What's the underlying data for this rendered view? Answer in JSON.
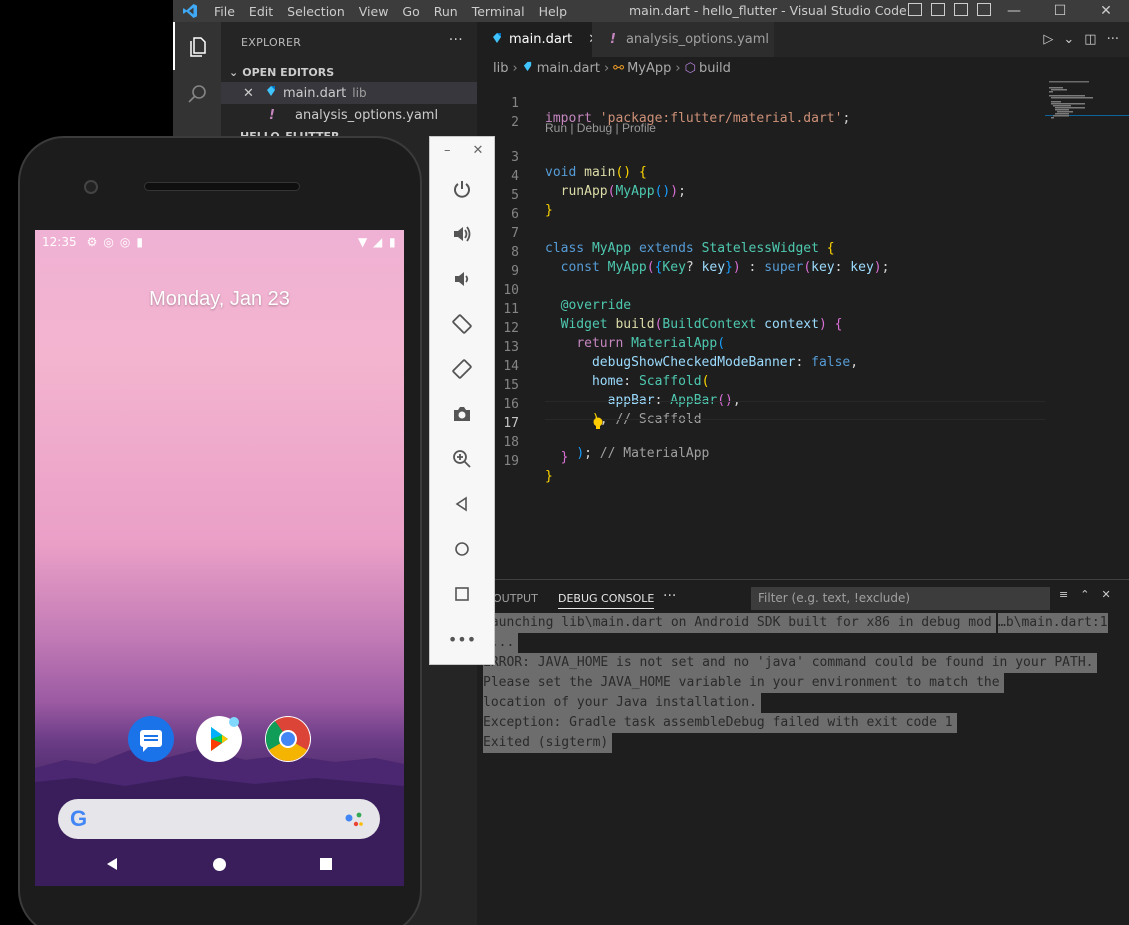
{
  "titlebar": {
    "menus": [
      "File",
      "Edit",
      "Selection",
      "View",
      "Go",
      "Run",
      "Terminal",
      "Help"
    ],
    "title": "main.dart - hello_flutter - Visual Studio Code"
  },
  "sidebar": {
    "header": "EXPLORER",
    "open_editors_label": "OPEN EDITORS",
    "open_editors": [
      {
        "name": "main.dart",
        "desc": "lib"
      },
      {
        "name": "analysis_options.yaml",
        "desc": ""
      }
    ],
    "folder_label": "HELLO_FLUTTER"
  },
  "tabs": [
    {
      "label": "main.dart",
      "active": true
    },
    {
      "label": "analysis_options.yaml",
      "active": false
    }
  ],
  "breadcrumb": [
    "lib",
    "main.dart",
    "MyApp",
    "build"
  ],
  "editor": {
    "codelens": "Run | Debug | Profile",
    "current_line": 17,
    "line_numbers": [
      "1",
      "2",
      "3",
      "4",
      "5",
      "6",
      "7",
      "8",
      "9",
      "10",
      "11",
      "12",
      "13",
      "14",
      "15",
      "16",
      "17",
      "18",
      "19"
    ],
    "lines": [
      "import 'package:flutter/material.dart';",
      "",
      "void main() {",
      "  runApp(MyApp());",
      "}",
      "",
      "class MyApp extends StatelessWidget {",
      "  const MyApp({Key? key}) : super(key: key);",
      "",
      "  @override",
      "  Widget build(BuildContext context) {",
      "    return MaterialApp(",
      "      debugShowCheckedModeBanner: false,",
      "      home: Scaffold(",
      "        appBar: AppBar(),",
      "      ), // Scaffold",
      "    ); // MaterialApp",
      "  }",
      "}"
    ]
  },
  "panel": {
    "tabs": [
      "OUTPUT",
      "DEBUG CONSOLE"
    ],
    "active_tab": "DEBUG CONSOLE",
    "filter_placeholder": "Filter (e.g. text, !exclude)",
    "console": [
      "Launching lib\\main.dart on Android SDK built for x86 in debug mod",
      "e...",
      "ERROR: JAVA_HOME is not set and no 'java' command could be found in your PATH.",
      "Please set the JAVA_HOME variable in your environment to match the",
      "location of your Java installation.",
      "Exception: Gradle task assembleDebug failed with exit code 1",
      "Exited (sigterm)"
    ],
    "console_link": "…b\\main.dart:1"
  },
  "phone": {
    "time": "12:35",
    "date": "Monday, Jan 23",
    "dock_apps": [
      "messages-app",
      "play-store-app",
      "chrome-app"
    ]
  },
  "colors": {
    "accent": "#007acc",
    "keyword": "#569cd6",
    "type": "#4ec9b0",
    "string": "#ce9178",
    "function": "#dcdcaa"
  }
}
